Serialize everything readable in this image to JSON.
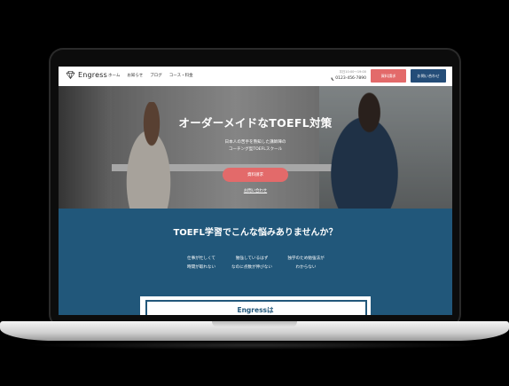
{
  "brand": {
    "name": "Engress"
  },
  "nav": {
    "items": [
      "ホーム",
      "お知らせ",
      "ブログ",
      "コース・料金"
    ]
  },
  "contact": {
    "hours": "平日10:00～19:00",
    "phone": "0123-456-7890"
  },
  "header_buttons": {
    "materials": "資料請求",
    "contact": "お問い合わせ"
  },
  "hero": {
    "title": "オーダーメイドなTOEFL対策",
    "subtitle_line1": "日本人の苦手を熟知した講師陣の",
    "subtitle_line2": "コーチング型TOEFLスクール",
    "cta": "資料請求",
    "link": "お問い合わせ"
  },
  "problems": {
    "title": "TOEFL学習でこんな悩みありませんか？",
    "worries": [
      {
        "line1": "仕事が忙しくて",
        "line2": "時間が取れない"
      },
      {
        "line1": "勉強しているはず",
        "line2": "なのに点数が伸びない"
      },
      {
        "line1": "独学のため勉強法が",
        "line2": "わからない"
      }
    ]
  },
  "card": {
    "title": "Engressは"
  },
  "colors": {
    "accent": "#e36a6a",
    "navy": "#244d78",
    "section": "#21577a"
  }
}
